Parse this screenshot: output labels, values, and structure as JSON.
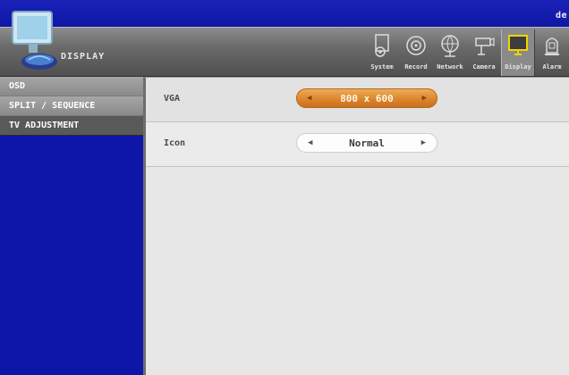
{
  "topbar": {
    "user": "de"
  },
  "app": {
    "title": "DISPLAY",
    "icon": "monitor-globe-icon"
  },
  "menu": [
    {
      "label": "System",
      "icon": "gear-document-icon"
    },
    {
      "label": "Record",
      "icon": "record-disc-icon"
    },
    {
      "label": "Network",
      "icon": "network-globe-icon"
    },
    {
      "label": "Camera",
      "icon": "cctv-camera-icon"
    },
    {
      "label": "Display",
      "icon": "monitor-icon",
      "active": true
    },
    {
      "label": "Alarm",
      "icon": "alarm-icon"
    }
  ],
  "sidebar": {
    "items": [
      {
        "label": "OSD"
      },
      {
        "label": "SPLIT / SEQUENCE"
      },
      {
        "label": "TV ADJUSTMENT",
        "selected": true
      }
    ]
  },
  "settings": {
    "vga": {
      "label": "VGA",
      "value": "800 x 600",
      "left_arrow": "◀",
      "right_arrow": "▶"
    },
    "icon": {
      "label": "Icon",
      "value": "Normal",
      "left_arrow": "◀",
      "right_arrow": "▶"
    }
  },
  "colors": {
    "background_blue": "#0d16a8",
    "accent_orange": "#d9822a",
    "panel_gray": "#e7e7e7"
  }
}
